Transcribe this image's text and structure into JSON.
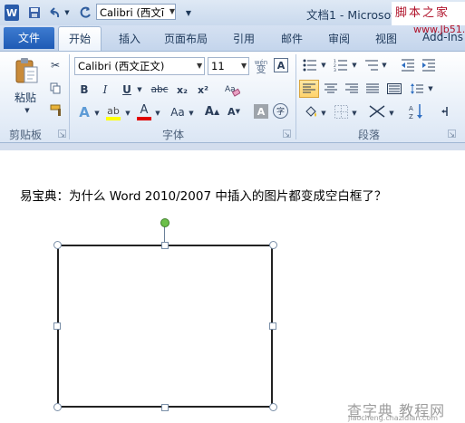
{
  "titlebar": {
    "app_icon": "W",
    "qat_save_icon": "save-icon",
    "qat_undo_icon": "undo-icon",
    "qat_redo_icon": "redo-icon",
    "font_name": "Calibri (西文ī",
    "doc_title": "文档1 - Microsoft",
    "watermark_line1": "脚本之家",
    "watermark_line2": "www.Jb51.net"
  },
  "tabs": {
    "file": "文件",
    "home": "开始",
    "insert": "插入",
    "page_layout": "页面布局",
    "references": "引用",
    "mailings": "邮件",
    "review": "审阅",
    "view": "视图",
    "addins": "Add-Ins"
  },
  "ribbon": {
    "clipboard": {
      "paste_label": "粘贴",
      "group_label": "剪贴板"
    },
    "font": {
      "font_name": "Calibri (西文正文)",
      "font_size": "11",
      "phonetic_glyph": "wén",
      "grow_glyph": "A",
      "shrink_glyph": "A",
      "bold": "B",
      "italic": "I",
      "underline": "U",
      "strike": "abc",
      "subscript": "x₂",
      "superscript": "x²",
      "change_case": "Aa",
      "group_label": "字体"
    },
    "paragraph": {
      "group_label": "段落"
    }
  },
  "document": {
    "body_text": "易宝典：为什么 Word 2010/2007 中插入的图片都变成空白框了？"
  },
  "watermark_bottom": {
    "line1": "查字典 教程网",
    "line2": "jiaocheng.chazidian.com"
  }
}
